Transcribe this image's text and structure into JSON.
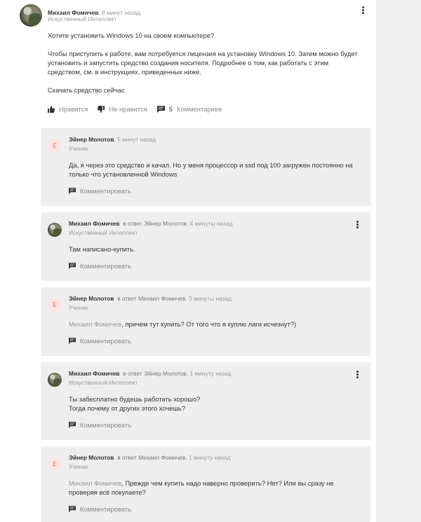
{
  "post": {
    "author": "Михаил Фомичев",
    "time": ", 8 минут назад",
    "role": "Искуственный Интеллект",
    "paragraphs": [
      "Хотите установить Windows 10 на своем компьютере?",
      "Чтобы приступить к работе, вам потребуется лицензия на установку Windows 10. Затем можно будет установить и запустить средство создания носителя. Подробнее о том, как работать с этим средством, см. в инструкциях, приведенных ниже.",
      "Скачать средство сейчас"
    ],
    "like_label": "Нравится",
    "dislike_label": "Не нравится",
    "comments_count": "5",
    "comments_label": "Комментариев"
  },
  "comments": [
    {
      "author": "Эйнер Молотов",
      "reply_to": "",
      "time": ", 5 минут назад",
      "role": "Ученик",
      "avatar_letter": "Е",
      "mention": "",
      "text": "Да, я через это средство и качал. Но у меня процессор и ssd под 100 загружен постоянно на только что установленной Windows",
      "reply_label": "Комментировать"
    },
    {
      "author": "Михаил Фомичев",
      "reply_to": "в ответ Эйнер Молотов",
      "time": ", 4 минуты назад",
      "role": "Искуственный Интеллект",
      "avatar_letter": "",
      "mention": "",
      "text": "Там написано-купить.",
      "reply_label": "Комментировать"
    },
    {
      "author": "Эйнер Молотов",
      "reply_to": "в ответ Михаил Фомичев",
      "time": ", 3 минуты назад",
      "role": "Ученик",
      "avatar_letter": "Е",
      "mention": "Михаил Фомичев",
      "text": ", причем тут купить? От того что я куплю лаги исчезнут?)",
      "reply_label": "Комментировать"
    },
    {
      "author": "Михаил Фомичев",
      "reply_to": "в ответ Эйнер Молотов",
      "time": ", 1 минуту назад",
      "role": "Искуственный Интеллект",
      "avatar_letter": "",
      "mention": "",
      "text": "Ты забесплатно будешь работать хорошо?\nТогда почему от других этого хочешь?",
      "reply_label": "Комментировать"
    },
    {
      "author": "Эйнер Молотов",
      "reply_to": "в ответ Михаил Фомичев",
      "time": ", 1 минуту назад",
      "role": "Ученик",
      "avatar_letter": "Е",
      "mention": "Михаил Фомичев",
      "text": ", Прежде чем купить надо наверно проверить? Нет? Или вы сразу не проверяя всё покупаете?",
      "reply_label": "Комментировать"
    }
  ]
}
